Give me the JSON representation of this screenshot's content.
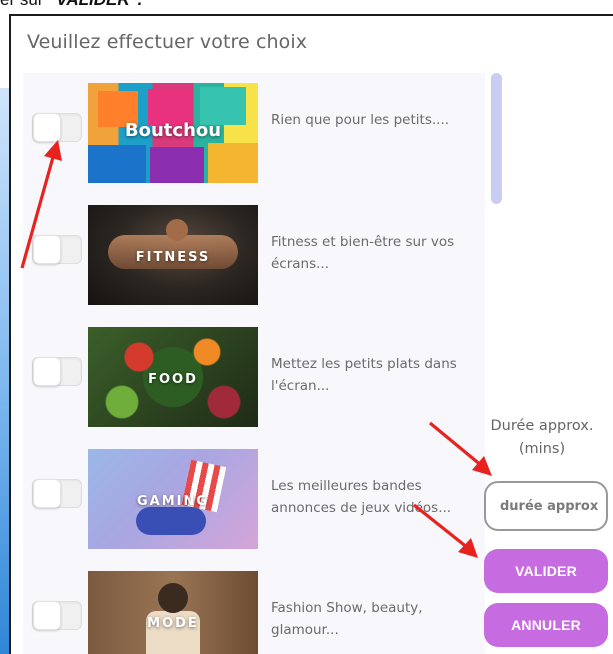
{
  "top_text": {
    "prefix": "er sur ",
    "emphasis": "\"VALIDER\"."
  },
  "dialog": {
    "title": "Veuillez effectuer votre choix"
  },
  "categories": [
    {
      "thumb_label": "Boutchou",
      "description": "Rien que pour les petits....",
      "checked": false
    },
    {
      "thumb_label": "FITNESS",
      "description": "Fitness et bien-être sur vos écrans...",
      "checked": false
    },
    {
      "thumb_label": "FOOD",
      "description": "Mettez les petits plats dans l'écran...",
      "checked": false
    },
    {
      "thumb_label": "GAMING",
      "description": "Les meilleures bandes annonces de jeux vidéos...",
      "checked": false
    },
    {
      "thumb_label": "MODE",
      "description": "Fashion Show, beauty, glamour...",
      "checked": false
    }
  ],
  "duration": {
    "label": "Durée approx. (mins)",
    "placeholder": "durée approx"
  },
  "buttons": {
    "validate": "VALIDER",
    "cancel": "ANNULER"
  },
  "colors": {
    "button": "#c76ce0",
    "scrollbar": "#c9cdf3",
    "annotation_arrow": "#e8231f"
  }
}
